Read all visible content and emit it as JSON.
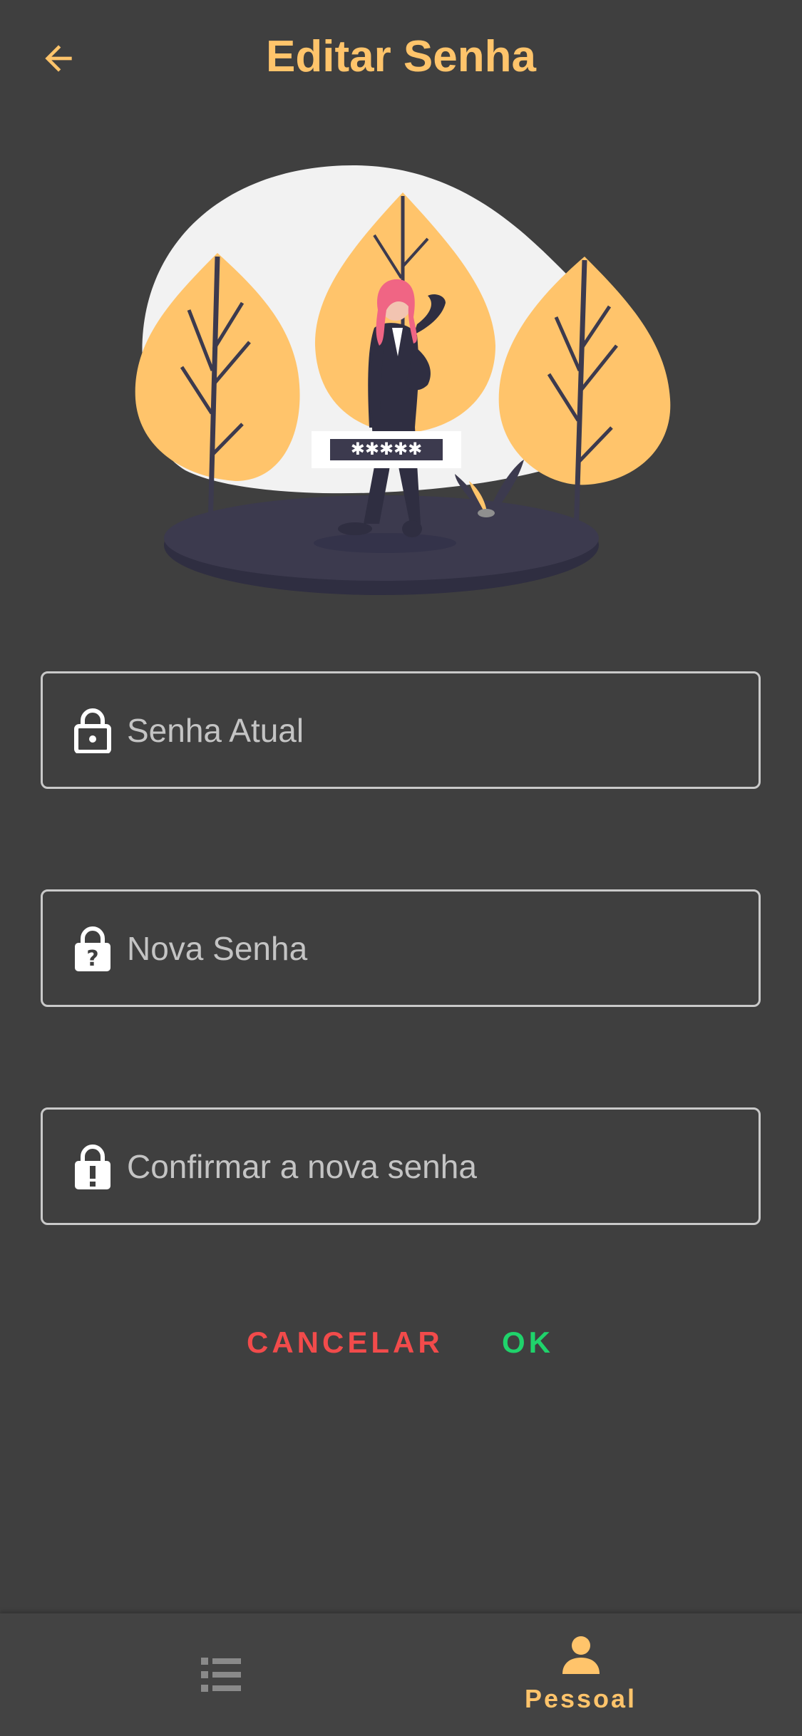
{
  "app_bar": {
    "title": "Editar Senha",
    "back_icon": "arrow-left-icon"
  },
  "illustration": {
    "password_mask": "✱✱✱✱✱",
    "colors": {
      "tree": "#ffc46b",
      "ground": "#3c3a4e",
      "blob": "#f2f2f2",
      "hair": "#f06584"
    }
  },
  "form": {
    "current_password": {
      "placeholder": "Senha Atual",
      "value": "",
      "icon": "lock-icon"
    },
    "new_password": {
      "placeholder": "Nova Senha",
      "value": "",
      "icon": "lock-question-icon"
    },
    "confirm_password": {
      "placeholder": "Confirmar a nova senha",
      "value": "",
      "icon": "lock-alert-icon"
    }
  },
  "actions": {
    "cancel_label": "CANCELAR",
    "ok_label": "OK"
  },
  "bottom_nav": {
    "items": [
      {
        "label": "",
        "icon": "list-icon",
        "active": false
      },
      {
        "label": "Pessoal",
        "icon": "person-icon",
        "active": true
      }
    ]
  },
  "colors": {
    "background": "#3f3f3f",
    "accent": "#ffc46b",
    "cancel": "#f24b4b",
    "ok": "#1fd36b",
    "inactive_icon": "#8a8a8a"
  }
}
